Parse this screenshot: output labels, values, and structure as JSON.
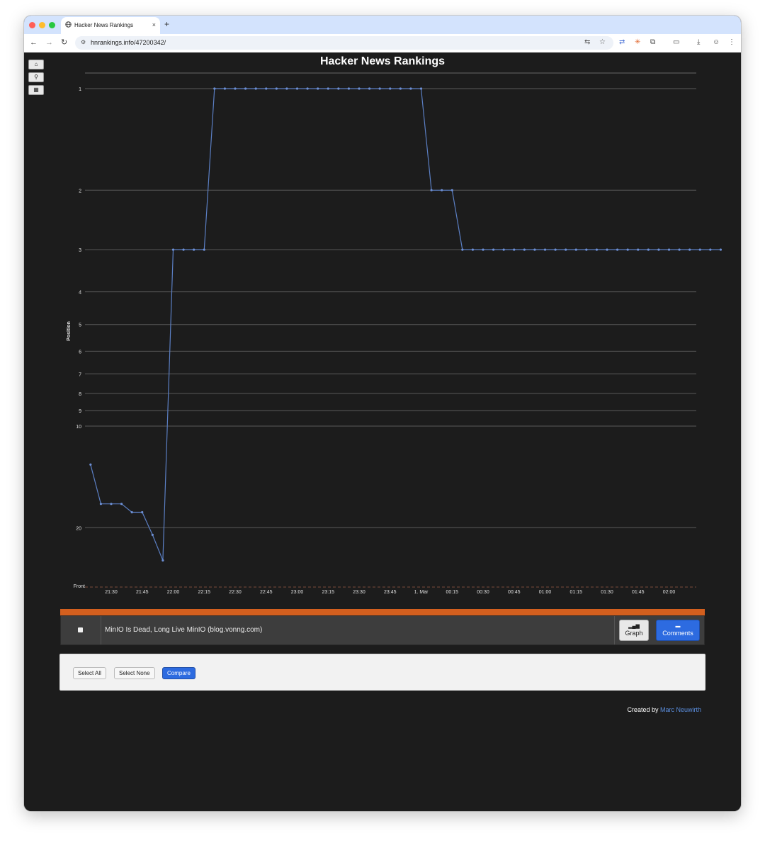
{
  "browser": {
    "tab_title": "Hacker News Rankings",
    "tab_close": "×",
    "new_tab": "+",
    "url": "hnrankings.info/47200342/"
  },
  "page": {
    "nav_buttons": [
      "home-icon",
      "search-icon",
      "grid-icon"
    ]
  },
  "chart_data": {
    "type": "line",
    "title": "Hacker News Rankings",
    "ylabel": "Position",
    "xlabel": "",
    "y_scale": "log",
    "y_reversed": true,
    "y_ticks": [
      "1",
      "2",
      "3",
      "4",
      "5",
      "6",
      "7",
      "8",
      "9",
      "10",
      "20",
      "Front"
    ],
    "x_ticks": [
      "21:30",
      "21:45",
      "22:00",
      "22:15",
      "22:30",
      "22:45",
      "23:00",
      "23:15",
      "23:30",
      "23:45",
      "1. Mar",
      "00:15",
      "00:30",
      "00:45",
      "01:00",
      "01:15",
      "01:30",
      "01:45",
      "02:00"
    ],
    "x_unit": "minutes since 21:30 on 28 Feb",
    "series": [
      {
        "name": "",
        "color": "#5b7fc4",
        "points": [
          [
            -10,
            13
          ],
          [
            -5,
            17
          ],
          [
            0,
            17
          ],
          [
            5,
            17
          ],
          [
            10,
            18
          ],
          [
            15,
            18
          ],
          [
            20,
            21
          ],
          [
            25,
            25
          ],
          [
            30,
            3
          ],
          [
            35,
            3
          ],
          [
            40,
            3
          ],
          [
            45,
            3
          ],
          [
            50,
            1
          ],
          [
            55,
            1
          ],
          [
            60,
            1
          ],
          [
            65,
            1
          ],
          [
            70,
            1
          ],
          [
            75,
            1
          ],
          [
            80,
            1
          ],
          [
            85,
            1
          ],
          [
            90,
            1
          ],
          [
            95,
            1
          ],
          [
            100,
            1
          ],
          [
            105,
            1
          ],
          [
            110,
            1
          ],
          [
            115,
            1
          ],
          [
            120,
            1
          ],
          [
            125,
            1
          ],
          [
            130,
            1
          ],
          [
            135,
            1
          ],
          [
            140,
            1
          ],
          [
            145,
            1
          ],
          [
            150,
            1
          ],
          [
            155,
            2
          ],
          [
            160,
            2
          ],
          [
            165,
            2
          ],
          [
            170,
            3
          ],
          [
            175,
            3
          ],
          [
            180,
            3
          ],
          [
            185,
            3
          ],
          [
            190,
            3
          ],
          [
            195,
            3
          ],
          [
            200,
            3
          ],
          [
            205,
            3
          ],
          [
            210,
            3
          ],
          [
            215,
            3
          ],
          [
            220,
            3
          ],
          [
            225,
            3
          ],
          [
            230,
            3
          ],
          [
            235,
            3
          ],
          [
            240,
            3
          ],
          [
            245,
            3
          ],
          [
            250,
            3
          ],
          [
            255,
            3
          ],
          [
            260,
            3
          ],
          [
            265,
            3
          ],
          [
            270,
            3
          ],
          [
            275,
            3
          ],
          [
            280,
            3
          ],
          [
            285,
            3
          ],
          [
            290,
            3
          ],
          [
            295,
            3
          ]
        ]
      }
    ],
    "grid": true
  },
  "story": {
    "title": "MinIO Is Dead, Long Live MinIO (blog.vonng.com)",
    "graph_label": "Graph",
    "comments_label": "Comments",
    "accent": "#d35f1e"
  },
  "controls": {
    "select_all": "Select All",
    "select_none": "Select None",
    "compare": "Compare"
  },
  "footer": {
    "created_by": "Created by",
    "author": "Marc Neuwirth"
  }
}
